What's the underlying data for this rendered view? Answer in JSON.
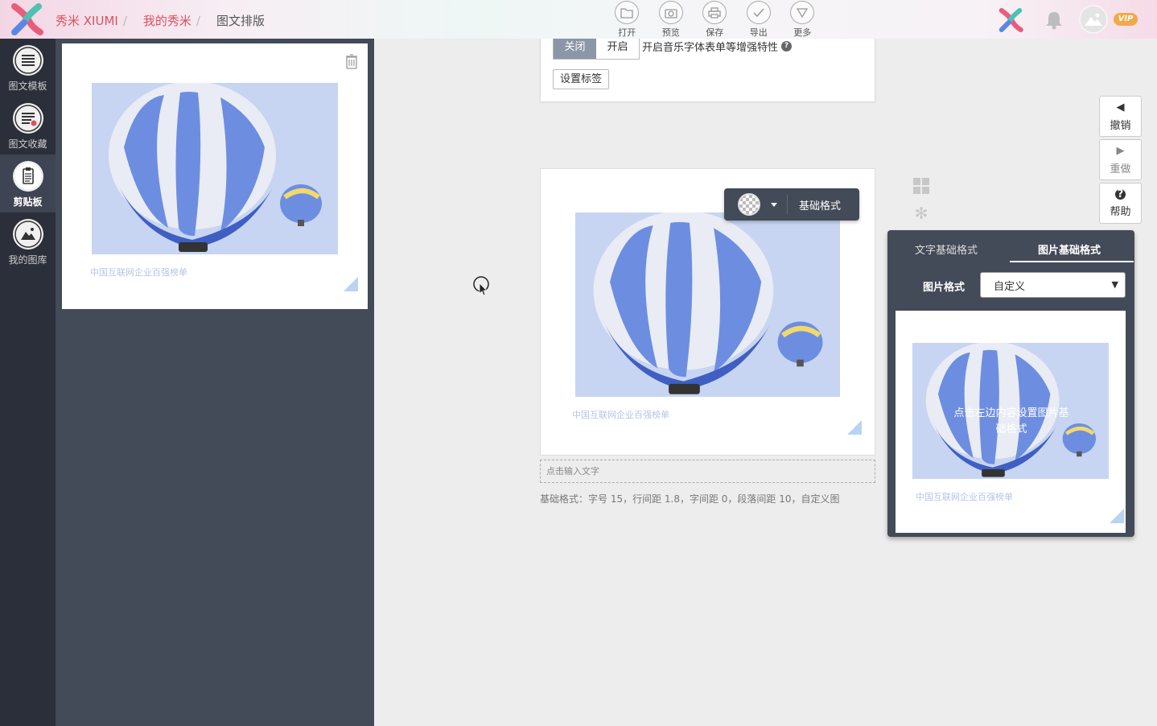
{
  "header": {
    "brand_label": "秀米 XIUMI",
    "breadcrumb": [
      "我的秀米",
      "图文排版"
    ],
    "toolbar": [
      {
        "label": "打开",
        "icon": "folder-icon"
      },
      {
        "label": "预览",
        "icon": "camera-icon"
      },
      {
        "label": "保存",
        "icon": "printer-icon"
      },
      {
        "label": "导出",
        "icon": "check-icon"
      },
      {
        "label": "更多",
        "icon": "triangle-down-icon"
      }
    ],
    "vip_badge": "VIP"
  },
  "sidebar": {
    "items": [
      {
        "label": "图文模板",
        "icon": "list-icon"
      },
      {
        "label": "图文收藏",
        "icon": "list-star-icon"
      },
      {
        "label": "剪贴板",
        "icon": "clipboard-icon",
        "active": true
      },
      {
        "label": "我的图库",
        "icon": "mountain-image-icon"
      }
    ]
  },
  "clipboard": {
    "caption": "中国互联网企业百强榜单"
  },
  "settings_card": {
    "off_label": "关闭",
    "on_label": "开启",
    "description": "开启音乐字体表单等增强特性",
    "tag_button": "设置标签"
  },
  "editor": {
    "caption": "中国互联网企业百强榜单",
    "float_toolbar_label": "基础格式",
    "text_placeholder": "点击输入文字",
    "format_note": "基础格式：字号 15，行间距 1.8，字间距 0，段落间距 10，自定义图"
  },
  "actions": {
    "undo": "撤销",
    "redo": "重做",
    "help": "帮助"
  },
  "format_panel": {
    "tab_text": "文字基础格式",
    "tab_image": "图片基础格式",
    "image_format_label": "图片格式",
    "image_format_value": "自定义",
    "preview_hint": "点击左边内容设置图片基础格式",
    "preview_caption": "中国互联网企业百强榜单"
  },
  "colors": {
    "brand_red": "#d9535f",
    "sidebar_bg": "#2b2f3a",
    "panel_bg": "#434a58",
    "balloon_bg": "#c7d5f2"
  }
}
